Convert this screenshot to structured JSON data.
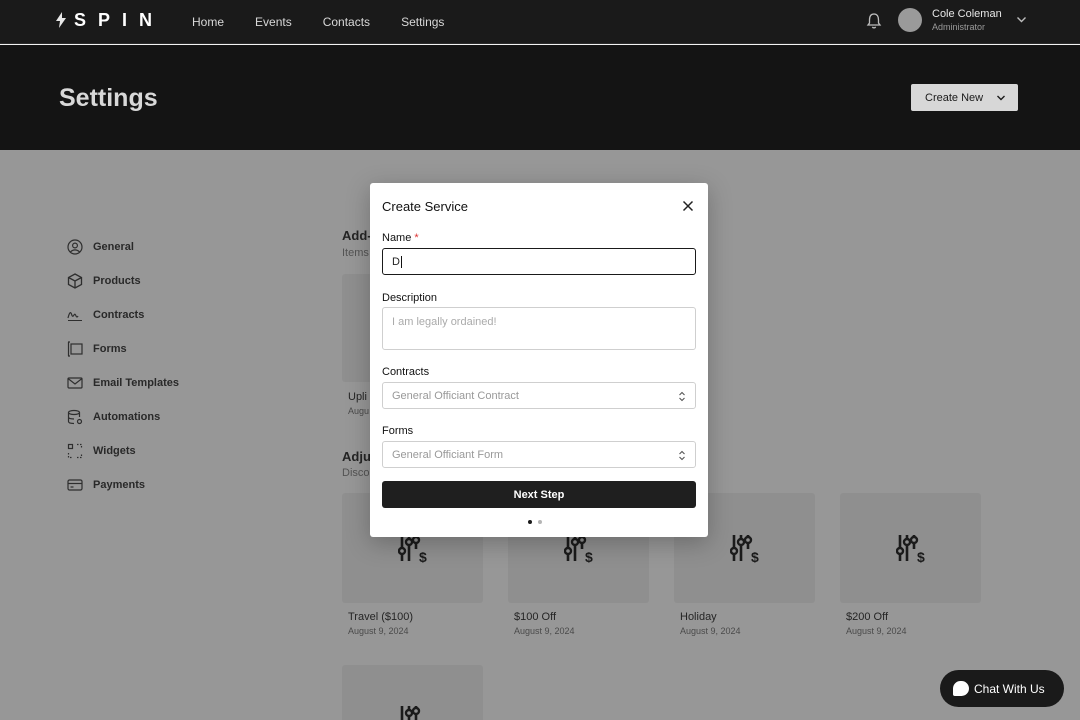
{
  "nav": {
    "logo_text": "SPIN",
    "links": [
      "Home",
      "Events",
      "Contacts",
      "Settings"
    ],
    "user": {
      "name": "Cole Coleman",
      "role": "Administrator"
    }
  },
  "header": {
    "title": "Settings",
    "create_new_label": "Create New"
  },
  "sidebar": {
    "items": [
      {
        "label": "General",
        "icon": "user-circle-icon"
      },
      {
        "label": "Products",
        "icon": "cube-icon"
      },
      {
        "label": "Contracts",
        "icon": "signature-icon"
      },
      {
        "label": "Forms",
        "icon": "form-icon"
      },
      {
        "label": "Email Templates",
        "icon": "mail-icon"
      },
      {
        "label": "Automations",
        "icon": "database-gear-icon"
      },
      {
        "label": "Widgets",
        "icon": "widgets-icon"
      },
      {
        "label": "Payments",
        "icon": "card-icon"
      }
    ]
  },
  "main": {
    "addons": {
      "title": "Add-",
      "subtitle": "Items",
      "card_name": "Upli",
      "card_date": "Augu"
    },
    "adjustments": {
      "title": "Adju",
      "subtitle": "Disco",
      "cards": [
        {
          "name": "Travel ($100)",
          "date": "August 9, 2024"
        },
        {
          "name": "$100 Off",
          "date": "August 9, 2024"
        },
        {
          "name": "Holiday",
          "date": "August 9, 2024"
        },
        {
          "name": "$200 Off",
          "date": "August 9, 2024"
        }
      ]
    }
  },
  "modal": {
    "title": "Create Service",
    "name_label": "Name",
    "required_mark": "*",
    "name_value": "D",
    "description_label": "Description",
    "description_placeholder": "I am legally ordained!",
    "contracts_label": "Contracts",
    "contracts_value": "General Officiant Contract",
    "forms_label": "Forms",
    "forms_value": "General Officiant Form",
    "next_label": "Next Step",
    "step": {
      "current": 1,
      "total": 2
    }
  },
  "chat": {
    "label": "Chat With Us"
  },
  "colors": {
    "dark": "#1a1a1a",
    "required": "#dd3333",
    "accent": "#1f1f1f"
  }
}
